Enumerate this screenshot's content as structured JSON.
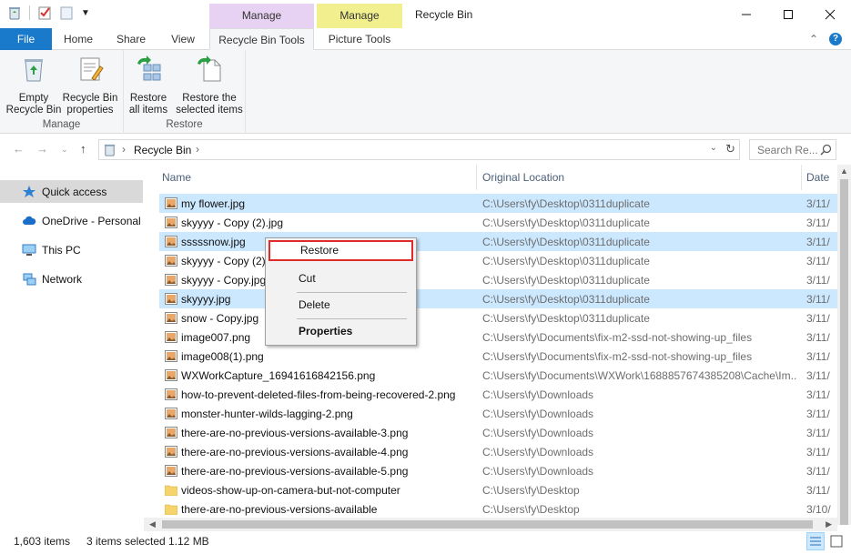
{
  "window": {
    "title": "Recycle Bin",
    "contextual_manage_1": "Manage",
    "contextual_manage_2": "Manage"
  },
  "tabs": {
    "file": "File",
    "home": "Home",
    "share": "Share",
    "view": "View",
    "recycle_bin_tools": "Recycle Bin Tools",
    "picture_tools": "Picture Tools"
  },
  "ribbon": {
    "empty_recycle_bin": "Empty\nRecycle Bin",
    "recycle_bin_properties": "Recycle Bin\nproperties",
    "group_manage": "Manage",
    "restore_all": "Restore\nall items",
    "restore_selected": "Restore the\nselected items",
    "group_restore": "Restore"
  },
  "address": {
    "path": "Recycle Bin",
    "search_placeholder": "Search Re..."
  },
  "nav": {
    "items": [
      {
        "label": "Quick access",
        "icon": "star-icon"
      },
      {
        "label": "OneDrive - Personal",
        "icon": "cloud-icon"
      },
      {
        "label": "This PC",
        "icon": "computer-icon"
      },
      {
        "label": "Network",
        "icon": "network-icon"
      }
    ]
  },
  "columns": {
    "name": "Name",
    "original_location": "Original Location",
    "date": "Date"
  },
  "files": [
    {
      "name": "my flower.jpg",
      "location": "C:\\Users\\fy\\Desktop\\0311duplicate",
      "date": "3/11/",
      "selected": true,
      "type": "image"
    },
    {
      "name": "skyyyy - Copy (2).jpg",
      "location": "C:\\Users\\fy\\Desktop\\0311duplicate",
      "date": "3/11/",
      "selected": false,
      "type": "image"
    },
    {
      "name": "sssssnow.jpg",
      "location": "C:\\Users\\fy\\Desktop\\0311duplicate",
      "date": "3/11/",
      "selected": true,
      "type": "image"
    },
    {
      "name": "skyyyy - Copy (2)",
      "location": "C:\\Users\\fy\\Desktop\\0311duplicate",
      "date": "3/11/",
      "selected": false,
      "type": "image"
    },
    {
      "name": "skyyyy - Copy.jpg",
      "location": "C:\\Users\\fy\\Desktop\\0311duplicate",
      "date": "3/11/",
      "selected": false,
      "type": "image"
    },
    {
      "name": "skyyyy.jpg",
      "location": "C:\\Users\\fy\\Desktop\\0311duplicate",
      "date": "3/11/",
      "selected": true,
      "type": "image"
    },
    {
      "name": "snow - Copy.jpg",
      "location": "C:\\Users\\fy\\Desktop\\0311duplicate",
      "date": "3/11/",
      "selected": false,
      "type": "image"
    },
    {
      "name": "image007.png",
      "location": "C:\\Users\\fy\\Documents\\fix-m2-ssd-not-showing-up_files",
      "date": "3/11/",
      "selected": false,
      "type": "image"
    },
    {
      "name": "image008(1).png",
      "location": "C:\\Users\\fy\\Documents\\fix-m2-ssd-not-showing-up_files",
      "date": "3/11/",
      "selected": false,
      "type": "image"
    },
    {
      "name": "WXWorkCapture_16941616842156.png",
      "location": "C:\\Users\\fy\\Documents\\WXWork\\1688857674385208\\Cache\\Im...",
      "date": "3/11/",
      "selected": false,
      "type": "image"
    },
    {
      "name": "how-to-prevent-deleted-files-from-being-recovered-2.png",
      "location": "C:\\Users\\fy\\Downloads",
      "date": "3/11/",
      "selected": false,
      "type": "image"
    },
    {
      "name": "monster-hunter-wilds-lagging-2.png",
      "location": "C:\\Users\\fy\\Downloads",
      "date": "3/11/",
      "selected": false,
      "type": "image"
    },
    {
      "name": "there-are-no-previous-versions-available-3.png",
      "location": "C:\\Users\\fy\\Downloads",
      "date": "3/11/",
      "selected": false,
      "type": "image"
    },
    {
      "name": "there-are-no-previous-versions-available-4.png",
      "location": "C:\\Users\\fy\\Downloads",
      "date": "3/11/",
      "selected": false,
      "type": "image"
    },
    {
      "name": "there-are-no-previous-versions-available-5.png",
      "location": "C:\\Users\\fy\\Downloads",
      "date": "3/11/",
      "selected": false,
      "type": "image"
    },
    {
      "name": "videos-show-up-on-camera-but-not-computer",
      "location": "C:\\Users\\fy\\Desktop",
      "date": "3/11/",
      "selected": false,
      "type": "folder"
    },
    {
      "name": "there-are-no-previous-versions-available",
      "location": "C:\\Users\\fy\\Desktop",
      "date": "3/10/",
      "selected": false,
      "type": "folder"
    }
  ],
  "context_menu": {
    "restore": "Restore",
    "cut": "Cut",
    "delete": "Delete",
    "properties": "Properties"
  },
  "status": {
    "item_count": "1,603 items",
    "selected": "3 items selected",
    "size": "1.12 MB"
  },
  "colors": {
    "file_tab": "#1979ca",
    "manage_recycle": "#e8d2f3",
    "manage_picture": "#f2f08e",
    "selection": "#cce8ff",
    "highlight_border": "#e02b2b"
  }
}
